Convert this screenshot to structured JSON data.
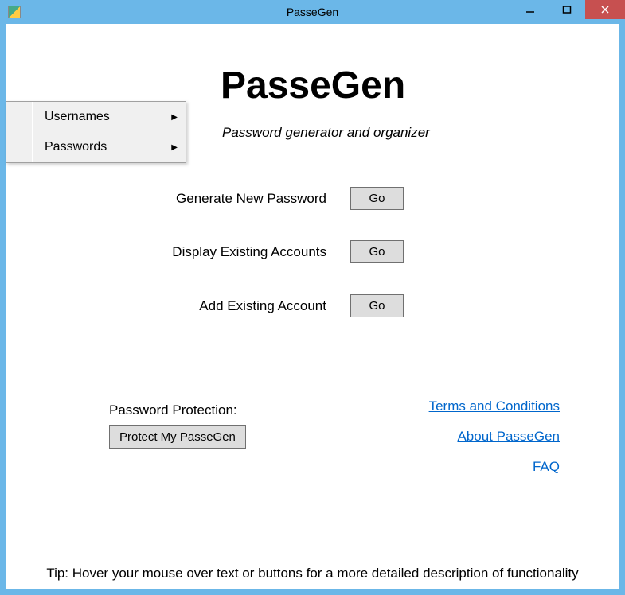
{
  "window": {
    "title": "PasseGen"
  },
  "menu": {
    "items": [
      {
        "label": "Usernames"
      },
      {
        "label": "Passwords"
      }
    ]
  },
  "header": {
    "title": "PasseGen",
    "subtitle": "Password generator and organizer"
  },
  "actions": {
    "generate": {
      "label": "Generate New Password",
      "button": "Go"
    },
    "display": {
      "label": "Display Existing Accounts",
      "button": "Go"
    },
    "add": {
      "label": "Add Existing Account",
      "button": "Go"
    }
  },
  "protection": {
    "label": "Password Protection:",
    "button": "Protect My PasseGen"
  },
  "links": {
    "terms": "Terms and Conditions",
    "about": "About PasseGen",
    "faq": "FAQ"
  },
  "tip": "Tip: Hover your mouse over text or buttons for a more detailed description of functionality"
}
